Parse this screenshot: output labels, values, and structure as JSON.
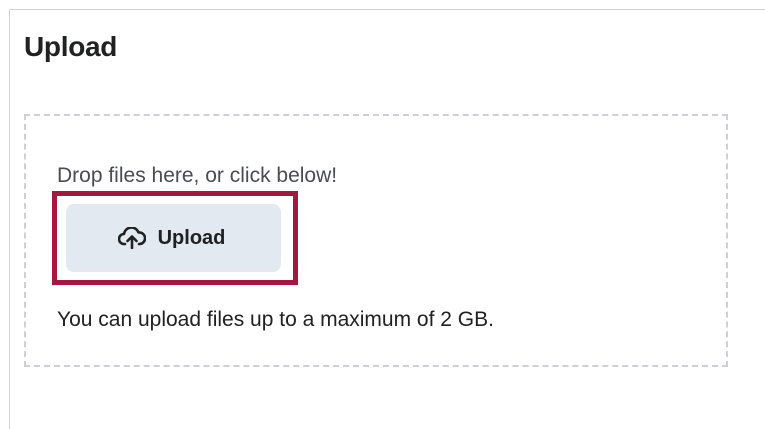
{
  "upload": {
    "title": "Upload",
    "drop_text": "Drop files here, or click below!",
    "button_label": "Upload",
    "button_icon": "cloud-upload-icon",
    "limit_text": "You can upload files up to a maximum of 2 GB."
  },
  "colors": {
    "highlight_border": "#a6173f",
    "button_bg": "#e3e9f1",
    "dropzone_border": "#cdd1d6"
  }
}
